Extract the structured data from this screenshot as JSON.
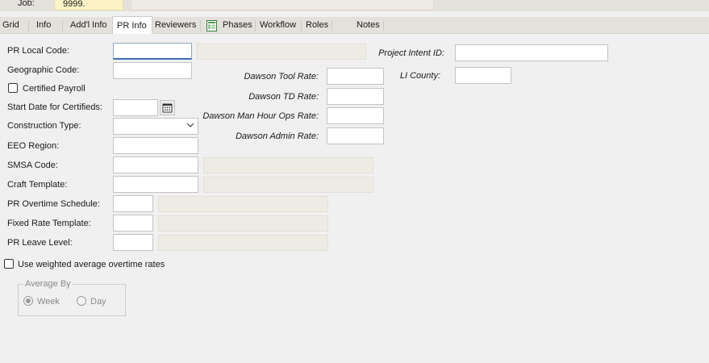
{
  "header": {
    "job_label": "Job:",
    "job_value": "9999."
  },
  "tabs": [
    {
      "label": "Grid"
    },
    {
      "label": "Info"
    },
    {
      "label": "Add'l Info"
    },
    {
      "label": "PR Info"
    },
    {
      "label": "Reviewers"
    },
    {
      "label": "Phases"
    },
    {
      "label": "Workflow"
    },
    {
      "label": "Roles"
    },
    {
      "label": "Notes"
    }
  ],
  "active_tab": "PR Info",
  "form": {
    "pr_local_code": {
      "label": "PR Local Code:",
      "value": ""
    },
    "geographic_code": {
      "label": "Geographic Code:",
      "value": ""
    },
    "certified_payroll": {
      "label": "Certified Payroll",
      "checked": false
    },
    "start_date_certifieds": {
      "label": "Start Date for Certifieds:",
      "value": ""
    },
    "construction_type": {
      "label": "Construction Type:",
      "value": ""
    },
    "eeo_region": {
      "label": "EEO Region:",
      "value": ""
    },
    "smsa_code": {
      "label": "SMSA Code:",
      "value": ""
    },
    "craft_template": {
      "label": "Craft Template:",
      "value": ""
    },
    "pr_overtime_schedule": {
      "label": "PR Overtime Schedule:",
      "value": ""
    },
    "fixed_rate_template": {
      "label": "Fixed Rate Template:",
      "value": ""
    },
    "pr_leave_level": {
      "label": "PR Leave Level:",
      "value": ""
    },
    "use_weighted_avg": {
      "label": "Use weighted average overtime rates",
      "checked": false
    },
    "average_by": {
      "title": "Average By",
      "options": [
        "Week",
        "Day"
      ],
      "selected": "Week"
    }
  },
  "dawson": {
    "tool_rate": {
      "label": "Dawson Tool Rate:",
      "value": ""
    },
    "td_rate": {
      "label": "Dawson TD Rate:",
      "value": ""
    },
    "man_hour_ops_rate": {
      "label": "Dawson Man Hour Ops Rate:",
      "value": ""
    },
    "admin_rate": {
      "label": "Dawson Admin Rate:",
      "value": ""
    }
  },
  "project": {
    "intent_id": {
      "label": "Project Intent ID:",
      "value": ""
    },
    "li_county": {
      "label": "LI County:",
      "value": ""
    }
  },
  "colors": {
    "readonly_bg": "#eeebe4",
    "job_bg": "#fbf3c6",
    "focus_border": "#3d6fb0",
    "tab_bar_bg": "#e4e1dc"
  },
  "icons": {
    "calendar": "calendar-icon",
    "dropdown": "chevron-down-icon",
    "phases": "spreadsheet-icon"
  }
}
